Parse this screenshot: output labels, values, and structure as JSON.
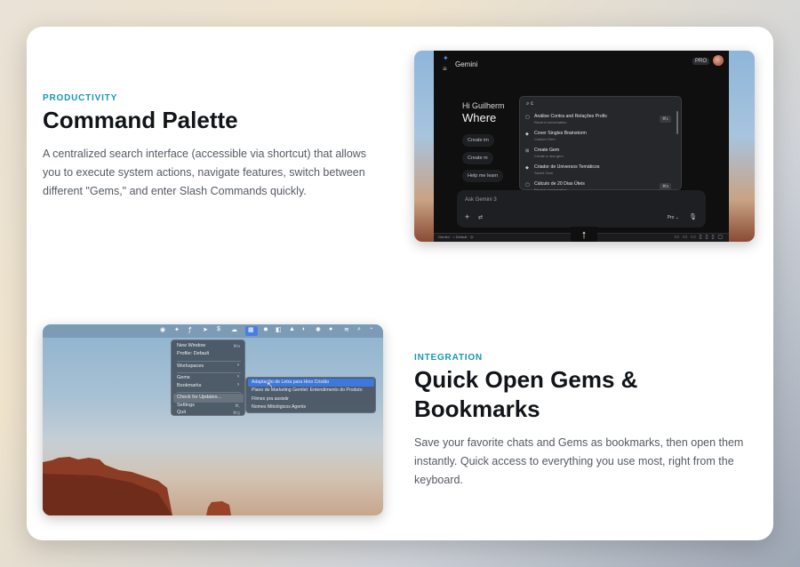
{
  "sections": [
    {
      "eyebrow": "PRODUCTIVITY",
      "title": "Command Palette",
      "description": "A centralized search interface (accessible via shortcut) that allows you to execute system actions, navigate features, switch between different \"Gems,\" and enter Slash Commands quickly."
    },
    {
      "eyebrow": "INTEGRATION",
      "title_line1": "Quick Open Gems &",
      "title_line2": "Bookmarks",
      "description": "Save your favorite chats and Gems as bookmarks, then open them instantly. Quick access to everything you use most, right from the keyboard."
    }
  ],
  "gemini_window": {
    "app_name": "Gemini",
    "pro_badge": "PRO",
    "greeting": "Hi Guilherm",
    "headline": "Where",
    "chips": [
      "Create im",
      "Create m",
      "Help me learn"
    ],
    "palette": {
      "query": "c",
      "items": [
        {
          "title": "Análise Contra and Relações Profis",
          "subtitle": "Recent conversation",
          "key": "⌘1"
        },
        {
          "title": "Cover Singles Brainstorm",
          "subtitle": "Custom Gem",
          "key": ""
        },
        {
          "title": "Create Gem",
          "subtitle": "Create a new gem",
          "key": ""
        },
        {
          "title": "Criador de Universos Temáticos",
          "subtitle": "Saved Gem",
          "key": ""
        },
        {
          "title": "Cálculo de 20 Dias Úteis",
          "subtitle": "Recent conversation",
          "key": "⌘5"
        }
      ]
    },
    "composer": {
      "placeholder": "Ask Gemini 3",
      "plus": "+",
      "tools": "⇄",
      "model": "Pro ⌄",
      "mic": "🎙"
    },
    "send_arrow": "↑",
    "statusbar_left": "Gemini · ⌂ Default · ◎",
    "statusbar_right": "▭ ▭ ▭ ▯ ▯ ▯ ▢"
  },
  "menubar": {
    "icons": [
      "◉",
      "✦",
      "ꝭ",
      "➤",
      "$",
      "☁",
      "▦",
      "✸",
      "◧",
      "▲",
      "◐",
      "✺",
      "●",
      "≋",
      "⌕",
      "◔"
    ],
    "menu": {
      "items": [
        {
          "label": "New Window",
          "key": "⌘N",
          "arrow": ""
        },
        {
          "label": "Profile: Default",
          "key": "",
          "arrow": ""
        },
        {
          "label": "Workspaces",
          "key": "",
          "arrow": "›"
        },
        {
          "label": "Gems",
          "key": "",
          "arrow": "›"
        },
        {
          "label": "Bookmarks",
          "key": "",
          "arrow": "›"
        },
        {
          "label": "Check for Updates...",
          "key": "",
          "arrow": ""
        },
        {
          "label": "Settings",
          "key": "⌘,",
          "arrow": ""
        },
        {
          "label": "Quit",
          "key": "⌘Q",
          "arrow": ""
        }
      ]
    },
    "submenu": {
      "items": [
        "Adaptação de Letra para Hino Cristão",
        "Plano de Marketing Gemlet: Entendimento do Produto",
        "Filmes pra assistir",
        "Nomes Mitológicos Agents"
      ]
    }
  },
  "colors": {
    "accent": "#1896b5",
    "title": "#111418",
    "body_text": "#555a62",
    "highlight": "#3f78dc"
  }
}
